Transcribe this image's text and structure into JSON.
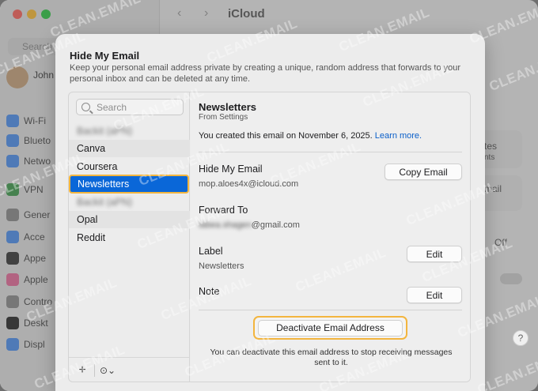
{
  "window": {
    "title": "iCloud",
    "search_placeholder": "Search",
    "user_name": "John",
    "sidebar_items": [
      "Wi-Fi",
      "Blueto",
      "Netwo",
      "VPN",
      "Gener",
      "Acce",
      "Appe",
      "Apple",
      "Contro",
      "Deskt",
      "Displ"
    ],
    "bg_right": {
      "tes": "tes",
      "nts": "nts",
      "mail": "mail",
      "off": "Off"
    }
  },
  "dialog": {
    "title": "Hide My Email",
    "description": "Keep your personal email address private by creating a unique, random address that forwards to your personal inbox and can be deleted at any time.",
    "search_placeholder": "Search",
    "list": [
      {
        "label": "Backit (aPN)",
        "blurred": true
      },
      {
        "label": "Canva",
        "blurred": false
      },
      {
        "label": "Coursera",
        "blurred": false
      },
      {
        "label": "Newsletters",
        "blurred": false,
        "selected": true
      },
      {
        "label": "Backit (aPN)",
        "blurred": true
      },
      {
        "label": "Opal",
        "blurred": false
      },
      {
        "label": "Reddit",
        "blurred": false
      }
    ],
    "footer": {
      "add": "+",
      "more": "⊙⌄"
    },
    "detail": {
      "title": "Newsletters",
      "subtitle": "From Settings",
      "created_text": "You created this email on November 6, 2025.",
      "learn_more": "Learn more.",
      "hide_my_email_label": "Hide My Email",
      "hide_my_email_value": "mop.aloes4x@icloud.com",
      "copy_button": "Copy Email",
      "forward_label": "Forward To",
      "forward_value_hidden": "tabea.shagen",
      "forward_value_domain": "@gmail.com",
      "label_label": "Label",
      "label_value": "Newsletters",
      "label_edit": "Edit",
      "note_label": "Note",
      "note_edit": "Edit",
      "deactivate_button": "Deactivate Email Address",
      "deactivate_note": "You can deactivate this email address to stop receiving messages sent to it."
    }
  },
  "watermark": "CLEAN.EMAIL",
  "help": "?",
  "colors": {
    "accent": "#0a67d8",
    "highlight": "#f3b53e",
    "link": "#0a5fc9"
  }
}
